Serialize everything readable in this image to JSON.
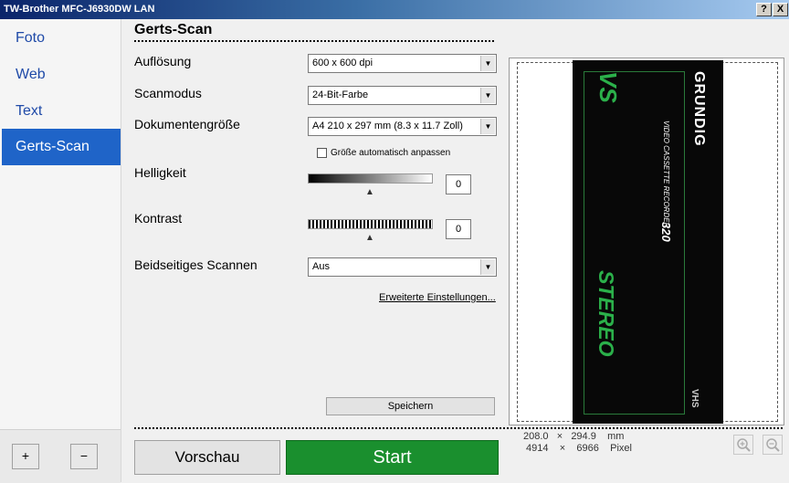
{
  "window": {
    "title": "TW-Brother MFC-J6930DW LAN",
    "help_button": "?",
    "close_button": "X"
  },
  "sidebar": {
    "items": [
      {
        "label": "Foto"
      },
      {
        "label": "Web"
      },
      {
        "label": "Text"
      },
      {
        "label": "Gerts-Scan"
      }
    ],
    "add_label": "+",
    "remove_label": "−"
  },
  "settings": {
    "title": "Gerts-Scan",
    "resolution": {
      "label": "Auflösung",
      "value": "600 x 600 dpi"
    },
    "scan_mode": {
      "label": "Scanmodus",
      "value": "24-Bit-Farbe"
    },
    "document_size": {
      "label": "Dokumentengröße",
      "value": "A4 210 x 297 mm (8.3 x 11.7 Zoll)"
    },
    "auto_fit": {
      "label": "Größe automatisch anpassen",
      "checked": false
    },
    "brightness": {
      "label": "Helligkeit",
      "value": "0"
    },
    "contrast": {
      "label": "Kontrast",
      "value": "0"
    },
    "duplex": {
      "label": "Beidseitiges Scannen",
      "value": "Aus"
    },
    "advanced_link": "Erweiterte Einstellungen...",
    "save_label": "Speichern"
  },
  "actions": {
    "preview_label": "Vorschau",
    "start_label": "Start"
  },
  "preview": {
    "scan_text": {
      "brand": "GRUNDIG",
      "model_line": "VIDEO CASSETTE RECORDER",
      "model_number": "320",
      "stereo": "STEREO",
      "logo": "VS",
      "vhs": "VHS"
    },
    "size_mm": {
      "width": "208.0",
      "x": "×",
      "height": "294.9",
      "unit": "mm"
    },
    "size_px": {
      "width": "4914",
      "x": "×",
      "height": "6966",
      "unit": "Pixel"
    }
  }
}
